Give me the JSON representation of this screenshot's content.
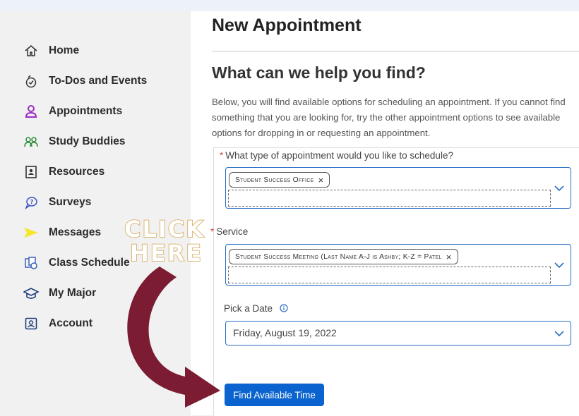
{
  "sidebar": {
    "items": [
      {
        "label": "Home",
        "icon": "home-icon"
      },
      {
        "label": "To-Dos and Events",
        "icon": "todo-icon"
      },
      {
        "label": "Appointments",
        "icon": "person-icon"
      },
      {
        "label": "Study Buddies",
        "icon": "study-buddies-icon"
      },
      {
        "label": "Resources",
        "icon": "resources-icon"
      },
      {
        "label": "Surveys",
        "icon": "surveys-icon"
      },
      {
        "label": "Messages",
        "icon": "messages-icon"
      },
      {
        "label": "Class Schedule",
        "icon": "class-schedule-icon"
      },
      {
        "label": "My Major",
        "icon": "graduation-cap-icon"
      },
      {
        "label": "Account",
        "icon": "account-icon"
      }
    ]
  },
  "main": {
    "page_title": "New Appointment",
    "heading": "What can we help you find?",
    "intro": "Below, you will find available options for scheduling an appointment. If you cannot find something that you are looking for, try the other appointment options to see available options for dropping in or requesting an appointment.",
    "type_field": {
      "required_mark": "*",
      "label": "What type of appointment would you like to schedule?",
      "chip": "Student Success Office",
      "remove": "×"
    },
    "service_field": {
      "required_mark": "*",
      "label": "Service",
      "chip": "Student Success Meeting (Last Name A-J is Ashby; K-Z = Patel",
      "remove": "×"
    },
    "date_field": {
      "label": "Pick a Date",
      "value": "Friday, August 19, 2022"
    },
    "find_button": "Find Available Time"
  },
  "overlay": {
    "line1": "CLICK",
    "line2": "HERE"
  },
  "colors": {
    "accent": "#0a63ce",
    "select_border": "#2a6ec4",
    "arrow": "#7b1c32",
    "overlay_stroke": "#d4a554",
    "required": "#d84747"
  }
}
